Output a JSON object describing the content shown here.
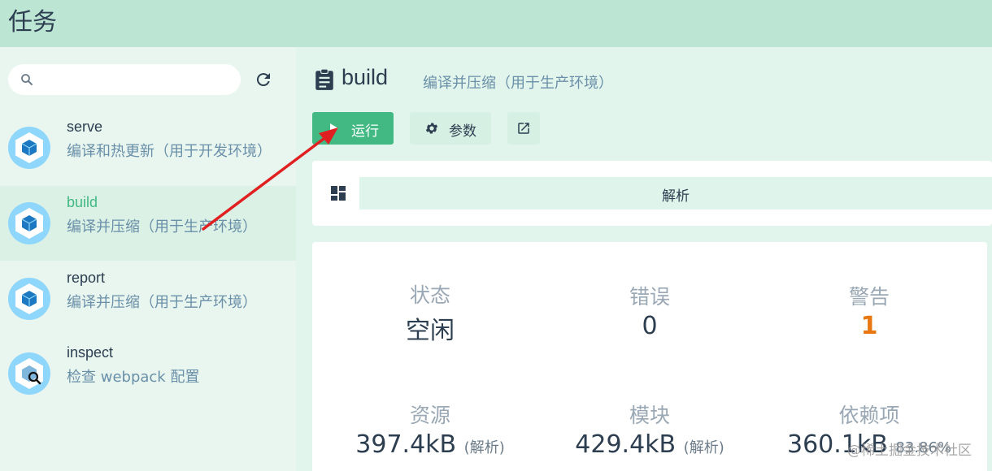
{
  "header": {
    "title": "任务"
  },
  "sidebar": {
    "search": {
      "value": "",
      "placeholder": ""
    },
    "tasks": [
      {
        "name": "serve",
        "description": "编译和热更新（用于开发环境）",
        "icon": "webpack-cube-icon"
      },
      {
        "name": "build",
        "description": "编译并压缩（用于生产环境）",
        "icon": "webpack-cube-icon",
        "active": true
      },
      {
        "name": "report",
        "description": "编译并压缩（用于生产环境）",
        "icon": "webpack-cube-icon"
      },
      {
        "name": "inspect",
        "description": "检查 webpack 配置",
        "icon": "webpack-inspect-icon"
      }
    ]
  },
  "main": {
    "title": "build",
    "subtitle": "编译并压缩（用于生产环境）",
    "buttons": {
      "run": "运行",
      "params": "参数"
    },
    "tab": "解析",
    "stats": {
      "status": {
        "label": "状态",
        "value": "空闲"
      },
      "errors": {
        "label": "错误",
        "value": "0"
      },
      "warnings": {
        "label": "警告",
        "value": "1"
      },
      "assets": {
        "label": "资源",
        "value": "397.4kB",
        "unit": "(解析)"
      },
      "modules": {
        "label": "模块",
        "value": "429.4kB",
        "unit": "(解析)"
      },
      "deps": {
        "label": "依赖项",
        "value": "360.1kB",
        "unit": "83.86%"
      }
    }
  },
  "watermark": "@稀土掘金技术社区",
  "colors": {
    "accent": "#42b983",
    "warning": "#e8770f",
    "arrow": "#e02020"
  }
}
